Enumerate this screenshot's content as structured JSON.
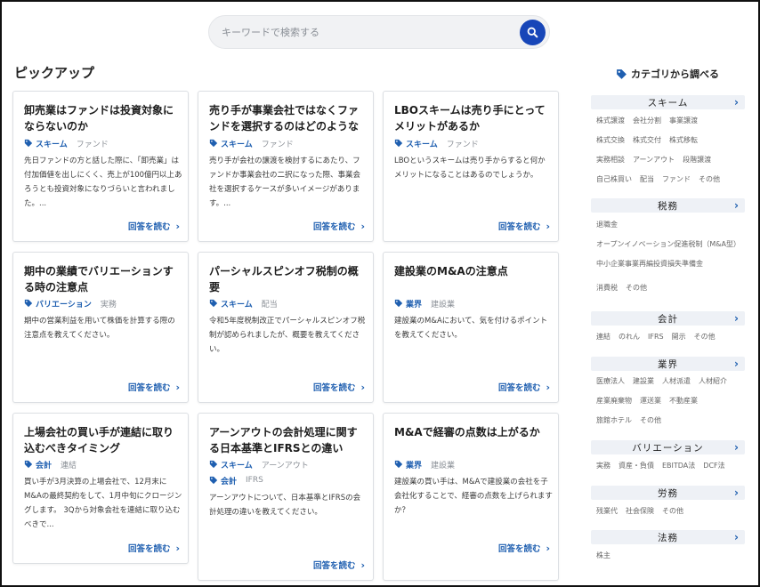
{
  "search": {
    "placeholder": "キーワードで検索する",
    "value": ""
  },
  "pickup": {
    "title": "ピックアップ",
    "read_more": "回答を読む",
    "cards": [
      {
        "title": "卸売業はファンドは投資対象にならないのか",
        "tags": [
          {
            "main": "スキーム",
            "sub": "ファンド"
          }
        ],
        "body": "先日ファンドの方と話した際に、「卸売業」は付加価値を出しにくく、売上が100億円以上あろうとも投資対象になりづらいと言われました。..."
      },
      {
        "title": "売り手が事業会社ではなくファンドを選択するのはどのようなケ...",
        "tags": [
          {
            "main": "スキーム",
            "sub": "ファンド"
          }
        ],
        "body": "売り手が会社の譲渡を検討するにあたり、ファンドか事業会社の二択になった際、事業会社を選択するケースが多いイメージがあります。..."
      },
      {
        "title": "LBOスキームは売り手にとってメリットがあるか",
        "tags": [
          {
            "main": "スキーム",
            "sub": "ファンド"
          }
        ],
        "body": "LBOというスキームは売り手からすると何かメリットになることはあるのでしょうか。"
      },
      {
        "title": "期中の業績でバリエーションする時の注意点",
        "tags": [
          {
            "main": "バリエーション",
            "sub": "実務"
          }
        ],
        "body": "期中の営業利益を用いて株価を計算する際の注意点を教えてください。"
      },
      {
        "title": "パーシャルスピンオフ税制の概要",
        "tags": [
          {
            "main": "スキーム",
            "sub": "配当"
          }
        ],
        "body": "令和5年度税制改正でパーシャルスピンオフ税制が認められましたが、概要を教えてください。"
      },
      {
        "title": "建設業のM&Aの注意点",
        "tags": [
          {
            "main": "業界",
            "sub": "建設業"
          }
        ],
        "body": "建設業のM&Aにおいて、気を付けるポイントを教えてください。"
      },
      {
        "title": "上場会社の買い手が連結に取り込むべきタイミング",
        "tags": [
          {
            "main": "会計",
            "sub": "連結"
          }
        ],
        "body": "買い手が3月決算の上場会社で、12月末にM&Aの最終契約をして、1月中旬にクロージングします。 3Qから対象会社を連結に取り込むべきで..."
      },
      {
        "title": "アーンアウトの会計処理に関する日本基準とIFRSとの違い",
        "tags": [
          {
            "main": "スキーム",
            "sub": "アーンアウト"
          },
          {
            "main": "会計",
            "sub": "IFRS"
          }
        ],
        "body": "アーンアウトについて、日本基準とIFRSの会計処理の違いを教えてください。"
      },
      {
        "title": "M&Aで経審の点数は上がるか",
        "tags": [
          {
            "main": "業界",
            "sub": "建設業"
          }
        ],
        "body": "建設業の買い手は、M&Aで建設業の会社を子会社化することで、経審の点数を上げられますか？"
      }
    ]
  },
  "sidebar": {
    "title": "カテゴリから調べる",
    "categories": [
      {
        "name": "スキーム",
        "items": [
          "株式譲渡",
          "会社分割",
          "事業譲渡",
          "株式交換",
          "株式交付",
          "株式移転",
          "実務相談",
          "アーンアウト",
          "段階譲渡",
          "自己株買い",
          "配当",
          "ファンド",
          "その他"
        ]
      },
      {
        "name": "税務",
        "items": [
          "退職金",
          "オープンイノベーション促進税制（M&A型）",
          "中小企業事業再編投資損失準備金",
          "消費税",
          "その他"
        ]
      },
      {
        "name": "会計",
        "items": [
          "連結",
          "のれん",
          "IFRS",
          "開示",
          "その他"
        ]
      },
      {
        "name": "業界",
        "items": [
          "医療法人",
          "建設業",
          "人材派遣",
          "人材紹介",
          "産業廃棄物",
          "運送業",
          "不動産業",
          "旅館ホテル",
          "その他"
        ]
      },
      {
        "name": "バリエーション",
        "items": [
          "実務",
          "資産・負債",
          "EBITDA法",
          "DCF法"
        ]
      },
      {
        "name": "労務",
        "items": [
          "残業代",
          "社会保険",
          "その他"
        ]
      },
      {
        "name": "法務",
        "items": [
          "株主"
        ]
      }
    ]
  },
  "colors": {
    "accent": "#1f5fb0",
    "search_button": "#1746b8",
    "category_header_bg": "#eef1f6"
  }
}
